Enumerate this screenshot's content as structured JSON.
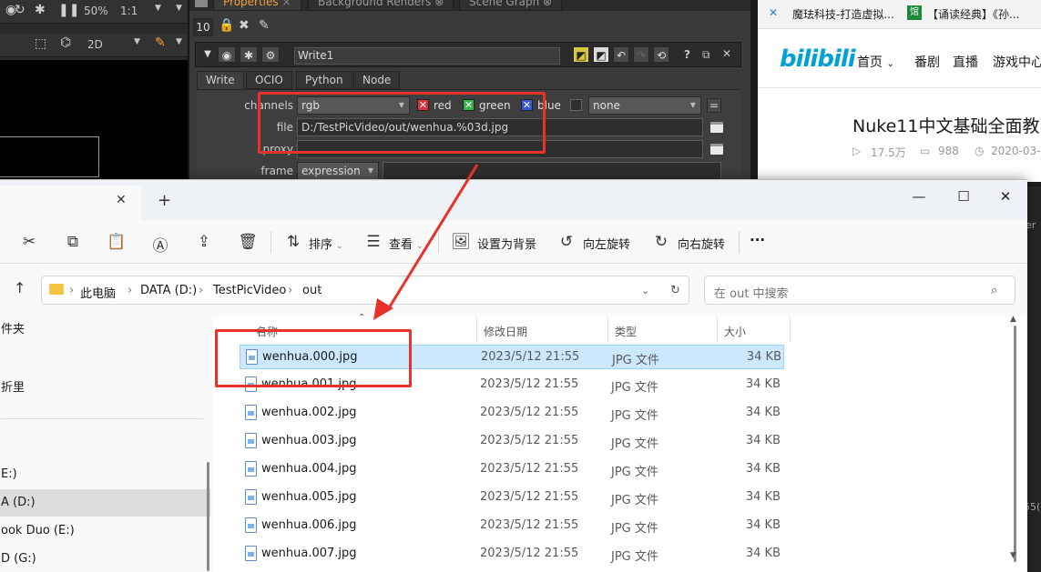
{
  "nuke": {
    "viewer": {
      "zoom": "50%",
      "ratio": "1:1",
      "view_mode": "2D"
    },
    "panel_tabs": [
      "Properties",
      "Background Renders",
      "Scene Graph"
    ],
    "max_panels": "10",
    "node_name": "Write1",
    "knob_tabs": [
      "Write",
      "OCIO",
      "Python",
      "Node"
    ],
    "knobs": {
      "channels_label": "channels",
      "channels_value": "rgb",
      "red_label": "red",
      "green_label": "green",
      "blue_label": "blue",
      "alpha_value": "none",
      "file_label": "file",
      "file_value": "D:/TestPicVideo/out/wenhua.%03d.jpg",
      "proxy_label": "proxy",
      "frame_label": "frame",
      "frame_value": "expression"
    }
  },
  "browser": {
    "tab1": "魔珐科技-打造虚拟...",
    "tab2": "【诵读经典】《孙...",
    "logo": "bilibili",
    "nav": [
      "首页",
      "番剧",
      "直播",
      "游戏中心"
    ],
    "video_title": "Nuke11中文基础全面教",
    "views": "17.5万",
    "danmaku": "988",
    "date": "2020-03-"
  },
  "explorer": {
    "toolbar": {
      "sort_label": "排序",
      "view_label": "查看",
      "set_background_label": "设置为背景",
      "rotate_left_label": "向左旋转",
      "rotate_right_label": "向右旋转",
      "more_label": "···"
    },
    "breadcrumb": [
      "此电脑",
      "DATA (D:)",
      "TestPicVideo",
      "out"
    ],
    "search_placeholder": "在 out 中搜索",
    "nav_items": [
      "件夹",
      "折里",
      "E:)",
      "A (D:)",
      "ook Duo (E:)",
      "D (G:)"
    ],
    "columns": [
      "名称",
      "修改日期",
      "类型",
      "大小"
    ],
    "files": [
      {
        "name": "wenhua.000.jpg",
        "date": "2023/5/12 21:55",
        "type": "JPG 文件",
        "size": "34 KB"
      },
      {
        "name": "wenhua.001.jpg",
        "date": "2023/5/12 21:55",
        "type": "JPG 文件",
        "size": "34 KB"
      },
      {
        "name": "wenhua.002.jpg",
        "date": "2023/5/12 21:55",
        "type": "JPG 文件",
        "size": "34 KB"
      },
      {
        "name": "wenhua.003.jpg",
        "date": "2023/5/12 21:55",
        "type": "JPG 文件",
        "size": "34 KB"
      },
      {
        "name": "wenhua.004.jpg",
        "date": "2023/5/12 21:55",
        "type": "JPG 文件",
        "size": "34 KB"
      },
      {
        "name": "wenhua.005.jpg",
        "date": "2023/5/12 21:55",
        "type": "JPG 文件",
        "size": "34 KB"
      },
      {
        "name": "wenhua.006.jpg",
        "date": "2023/5/12 21:55",
        "type": "JPG 文件",
        "size": "34 KB"
      },
      {
        "name": "wenhua.007.jpg",
        "date": "2023/5/12 21:55",
        "type": "JPG 文件",
        "size": "34 KB"
      }
    ]
  },
  "right_edge": {
    "label_top": "er",
    "label_bottom": "55("
  },
  "colors": {
    "annotation_red": "#e8312a",
    "nuke_accent": "#f2a13a",
    "bilibili_blue": "#00a1d6",
    "selection_blue": "#cce8ff"
  }
}
